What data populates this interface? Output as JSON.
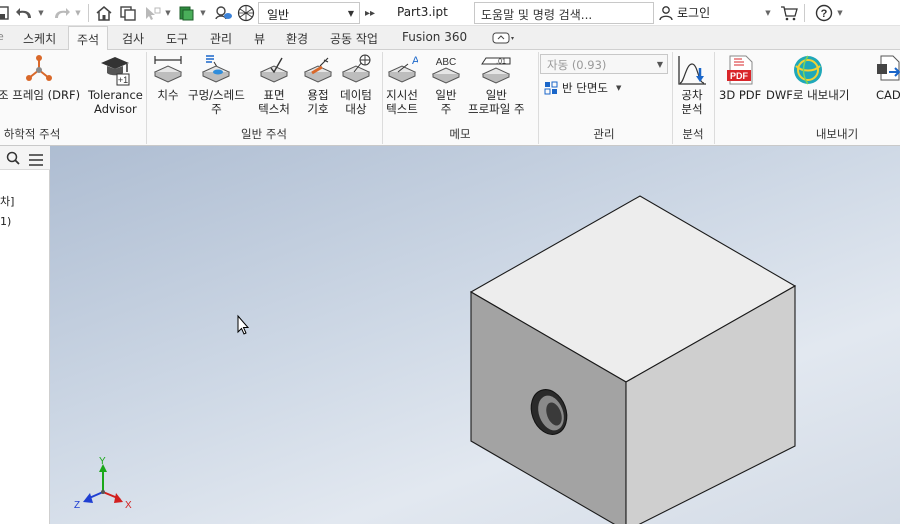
{
  "quick_access": {
    "style_value": "일반",
    "document_title": "Part3.ipt",
    "help_search_placeholder": "도움말 및 명령 검색...",
    "login_label": "로그인"
  },
  "tabs": [
    "스케치",
    "주석",
    "검사",
    "도구",
    "관리",
    "뷰",
    "환경",
    "공동 작업",
    "Fusion 360"
  ],
  "active_tab": "주석",
  "ribbon": {
    "geo_annotation": {
      "drf_label": "조 프레임 (DRF)",
      "tolerance_advisor_label": "Tolerance\nAdvisor",
      "group_label": "하학적 주석"
    },
    "general_annotation": {
      "buttons": [
        "치수",
        "구멍/스레드\n주",
        "표면\n텍스처",
        "용접\n기호",
        "데이텀\n대상"
      ],
      "group_label": "일반 주석"
    },
    "notes": {
      "buttons": [
        "지시선\n텍스트",
        "일반\n주",
        "일반\n프로파일 주"
      ],
      "group_label": "메모"
    },
    "manage": {
      "tolerance_value": "자동 (0.93)",
      "half_section_label": "반 단면도",
      "group_label": "관리"
    },
    "analysis": {
      "button": "공차\n분석",
      "group_label": "분석"
    },
    "export": {
      "buttons": [
        "3D PDF",
        "DWF로 내보내기",
        "CAD 형"
      ],
      "group_label": "내보내기"
    }
  },
  "browser": {
    "nodes": [
      "차]",
      "1)"
    ]
  },
  "viewport": {
    "triad": {
      "x": "X",
      "y": "Y",
      "z": "Z"
    },
    "colors": {
      "x_axis": "#d21f1f",
      "y_axis": "#1aa81a",
      "z_axis": "#1f3fd2"
    }
  }
}
